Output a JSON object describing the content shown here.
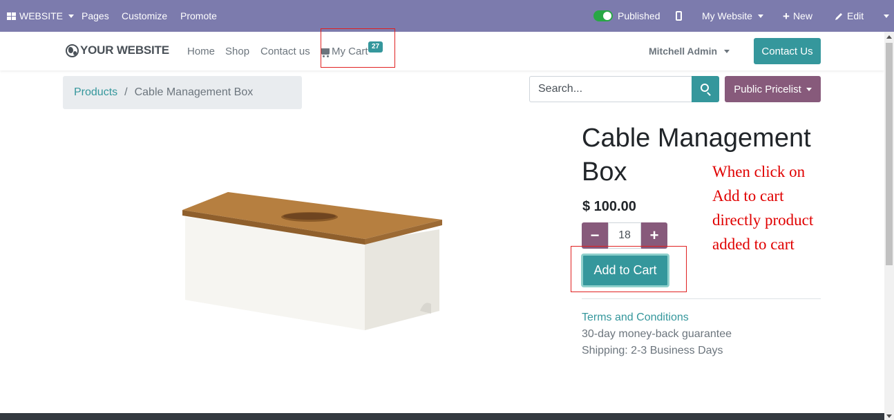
{
  "adminbar": {
    "website_label": "WEBSITE",
    "pages_label": "Pages",
    "customize_label": "Customize",
    "promote_label": "Promote",
    "published_label": "Published",
    "my_website_label": "My Website",
    "new_label": "New",
    "edit_label": "Edit",
    "color": "#7c7bad"
  },
  "header": {
    "logo_text": "YOUR WEBSITE",
    "nav": [
      "Home",
      "Shop",
      "Contact us"
    ],
    "cart_label": "My Cart",
    "cart_count": "27",
    "user_name": "Mitchell Admin",
    "contact_button": "Contact Us"
  },
  "breadcrumb": {
    "parent": "Products",
    "separator": "/",
    "current": "Cable Management Box"
  },
  "search": {
    "placeholder": "Search...",
    "pricelist_label": "Public Pricelist"
  },
  "product": {
    "name": "Cable Management Box",
    "price": "$ 100.00",
    "quantity": "18",
    "add_to_cart_label": "Add to Cart",
    "terms_link": "Terms and Conditions",
    "guarantee": "30-day money-back guarantee",
    "shipping": "Shipping: 2-3 Business Days"
  },
  "annotation": {
    "note": "When click on Add to cart directly product added to cart",
    "color": "#e00000"
  },
  "colors": {
    "primary": "#35979c",
    "secondary": "#875a7b"
  }
}
